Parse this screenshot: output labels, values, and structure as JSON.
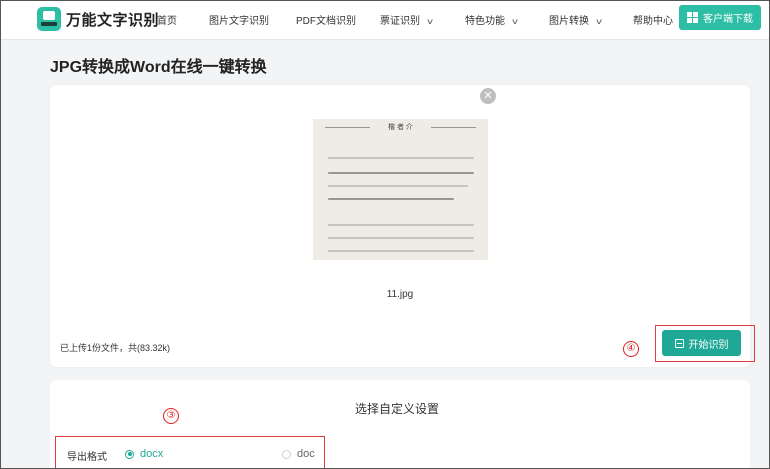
{
  "header": {
    "brand": "万能文字识别",
    "nav": [
      {
        "label": "首页",
        "dropdown": false
      },
      {
        "label": "图片文字识别",
        "dropdown": false
      },
      {
        "label": "PDF文档识别",
        "dropdown": false
      },
      {
        "label": "票证识别",
        "dropdown": true
      },
      {
        "label": "特色功能",
        "dropdown": true
      },
      {
        "label": "图片转换",
        "dropdown": true
      },
      {
        "label": "帮助中心",
        "dropdown": false
      }
    ],
    "client_download": "客户端下载"
  },
  "page_title": "JPG转换成Word在线一键转换",
  "upload": {
    "file_name": "11.jpg",
    "status": "已上传1份文件，共(83.32k)",
    "close_icon": "close-icon",
    "preview_heading": "楷 者 介"
  },
  "annotations": {
    "start_marker": "④",
    "export_marker": "③"
  },
  "start_button": {
    "label": "开始识别",
    "icon": "scan-icon"
  },
  "settings": {
    "title": "选择自定义设置",
    "export_format_label": "导出格式",
    "options": [
      {
        "label": "docx",
        "selected": true
      },
      {
        "label": "doc",
        "selected": false
      }
    ]
  },
  "colors": {
    "accent": "#1fa895",
    "brand": "#2dbfa6",
    "annotation": "#e23c3c"
  }
}
